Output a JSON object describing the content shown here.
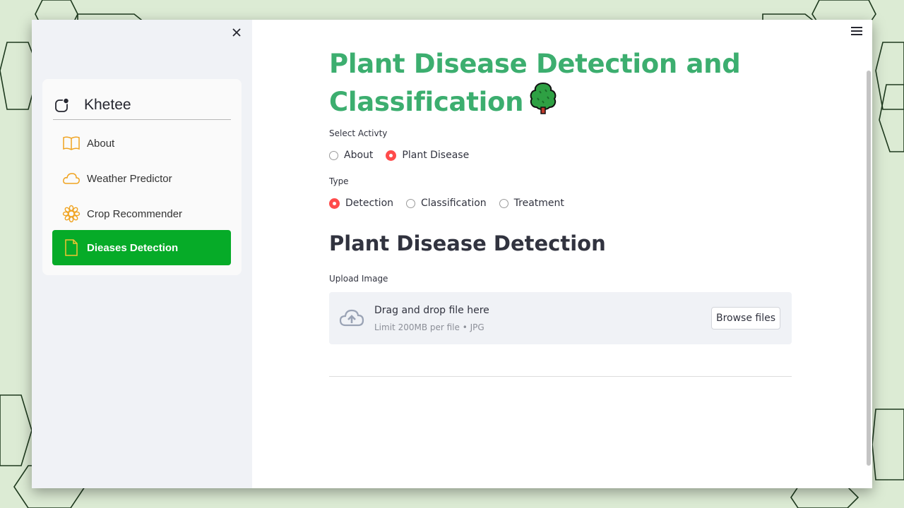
{
  "sidebar": {
    "menu_title": "Khetee",
    "items": [
      {
        "label": "About",
        "icon": "book-icon"
      },
      {
        "label": "Weather Predictor",
        "icon": "cloud-icon"
      },
      {
        "label": "Crop Recommender",
        "icon": "flower-icon"
      },
      {
        "label": "Dieases Detection",
        "icon": "file-icon",
        "active": true
      }
    ],
    "close_icon": "close-icon"
  },
  "main": {
    "title": "Plant Disease Detection and Classification",
    "title_icon": "tree-icon",
    "activity": {
      "label": "Select Activty",
      "options": [
        "About",
        "Plant Disease"
      ],
      "selected": "Plant Disease"
    },
    "type": {
      "label": "Type",
      "options": [
        "Detection",
        "Classification",
        "Treatment"
      ],
      "selected": "Detection"
    },
    "section_title": "Plant Disease Detection",
    "uploader": {
      "label": "Upload Image",
      "drop_text": "Drag and drop file here",
      "limit_text": "Limit 200MB per file • JPG",
      "browse_label": "Browse files"
    }
  },
  "colors": {
    "title_green": "#3cae6f",
    "active_menu": "#06ab28",
    "radio_checked": "#ff4b4b",
    "menu_icon": "#f0a320"
  }
}
